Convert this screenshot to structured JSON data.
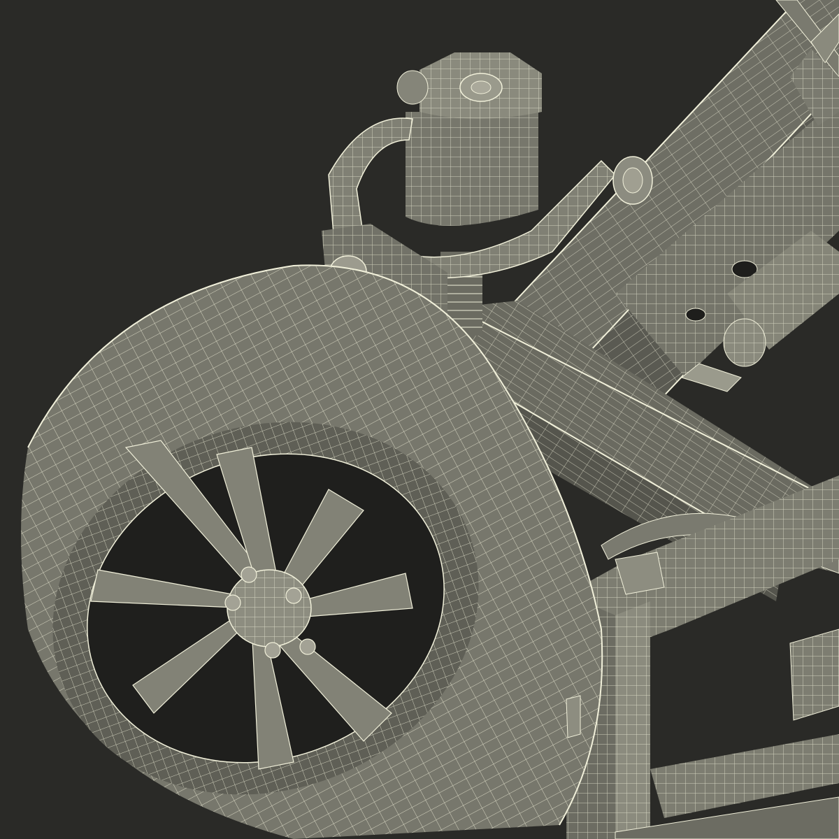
{
  "scene": {
    "background_color": "#2a2a27",
    "model_fill_color": "#7f7f73",
    "model_shade_color": "#5e5e55",
    "wireframe_color": "#f1f0da",
    "parts": [
      "wheel",
      "tire",
      "rim",
      "lug-nuts",
      "shock-absorber",
      "upper-control-arm",
      "axle-beam",
      "frame-rail",
      "cross-member",
      "leaf-spring"
    ]
  }
}
